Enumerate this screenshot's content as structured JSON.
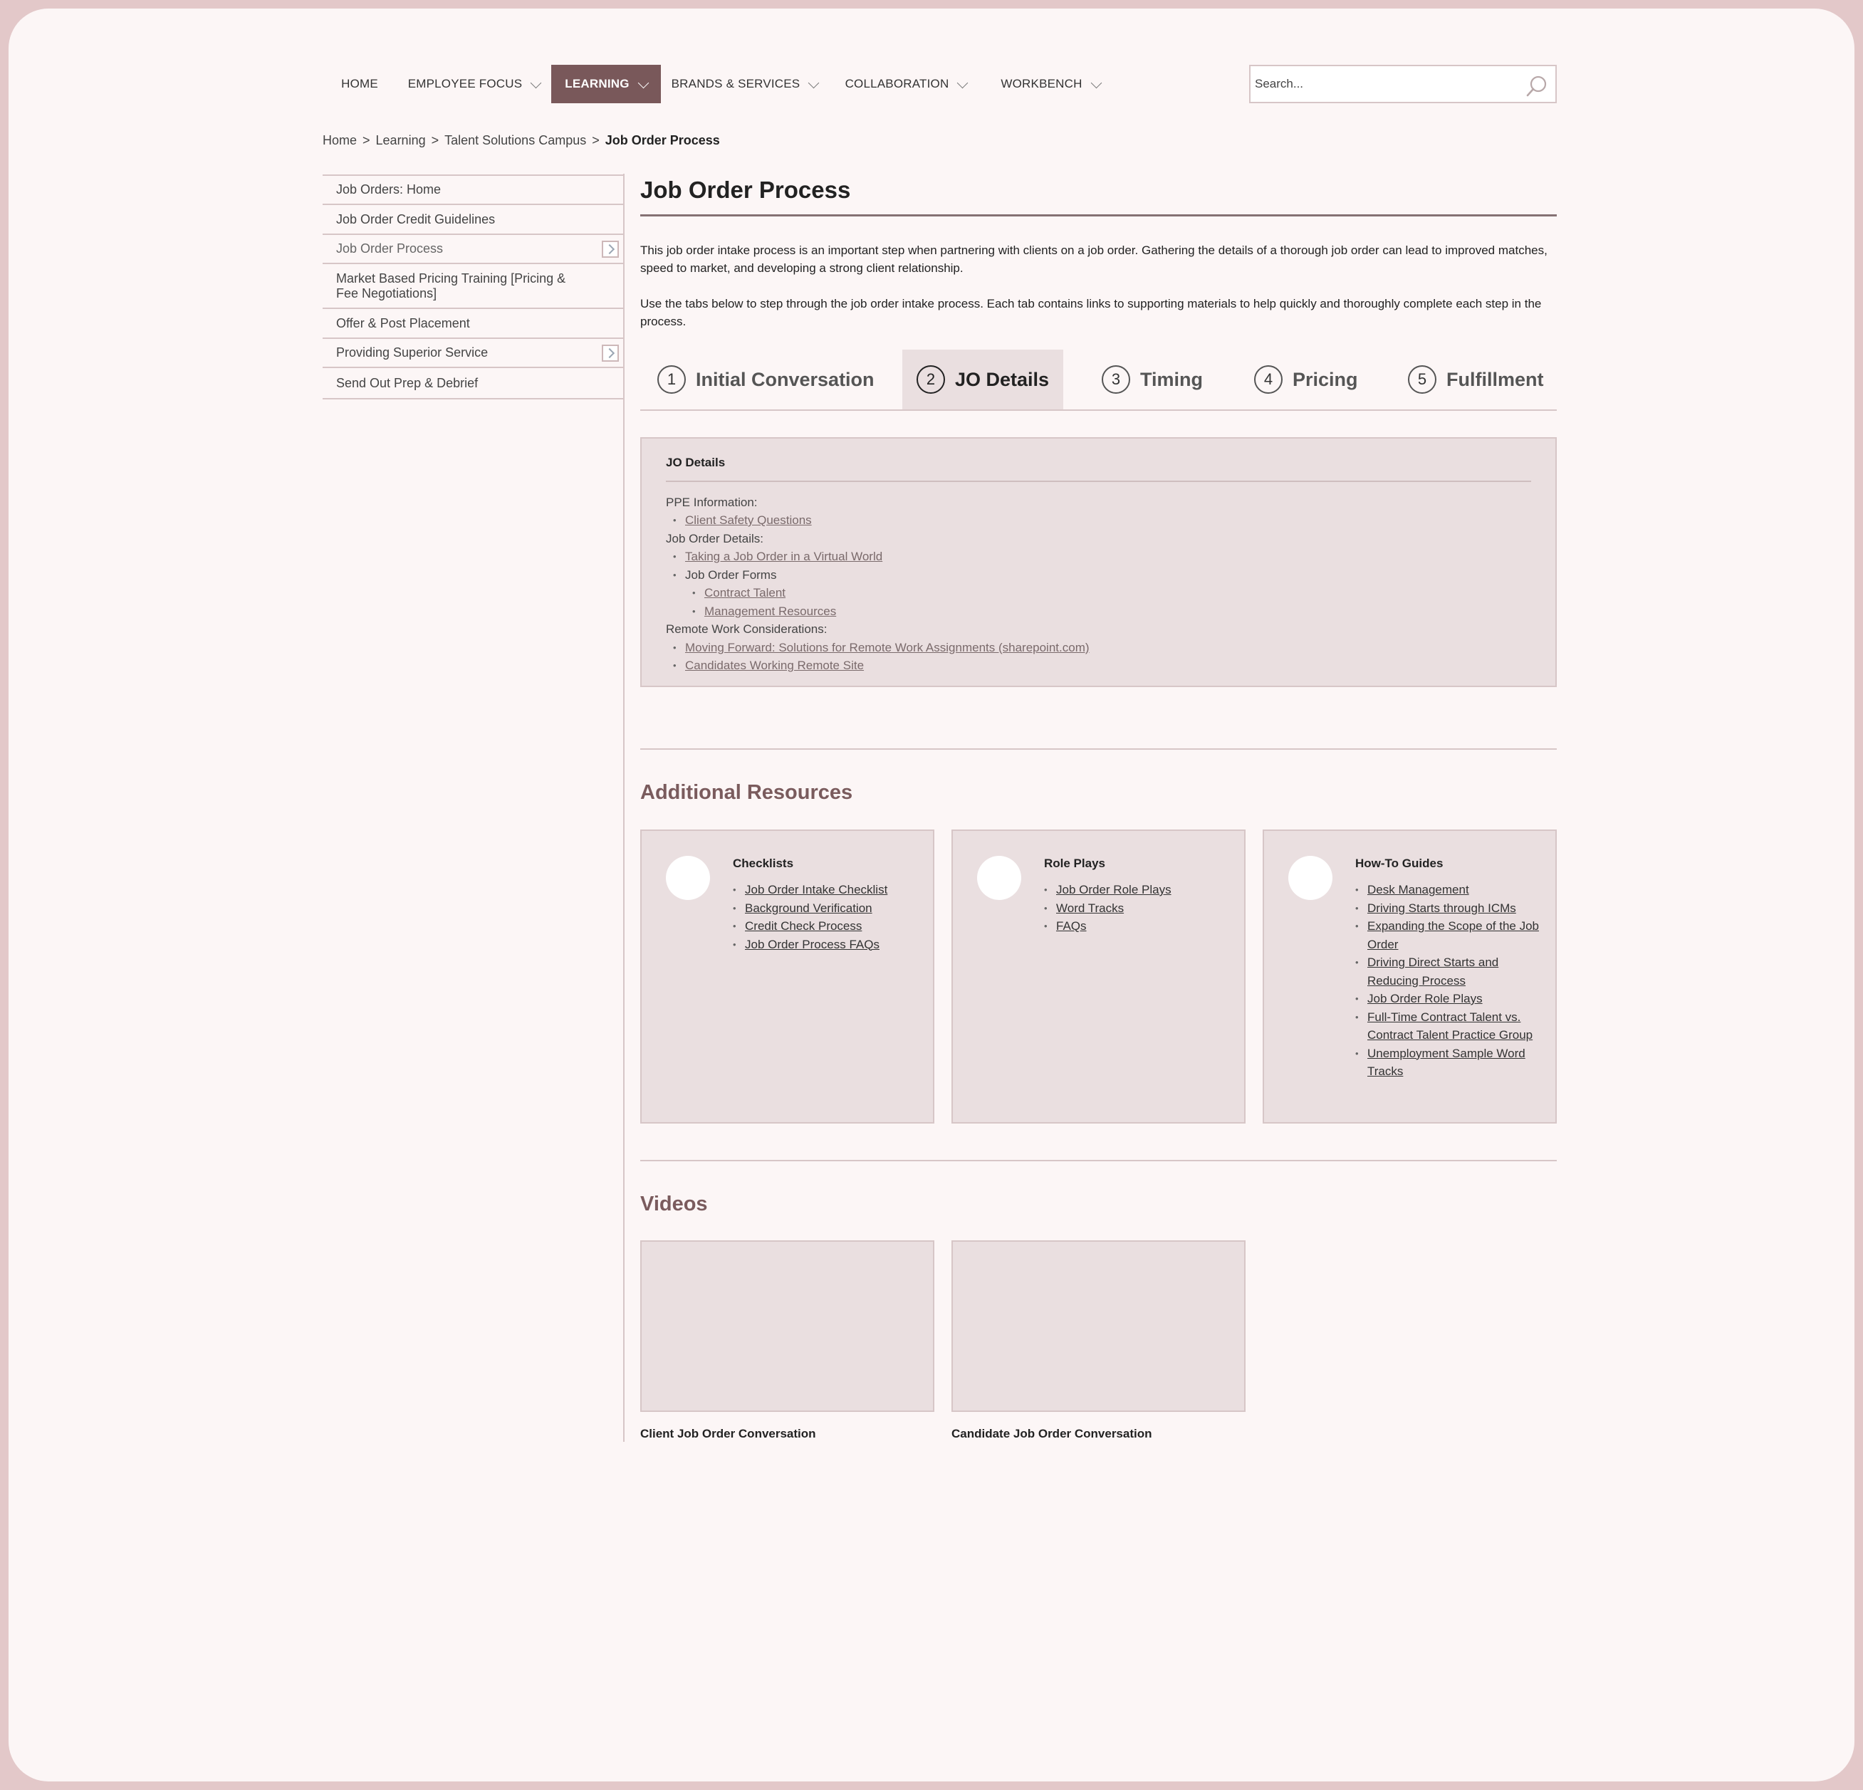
{
  "nav": {
    "items": [
      {
        "label": "HOME",
        "dropdown": false,
        "active": false
      },
      {
        "label": "EMPLOYEE FOCUS",
        "dropdown": true,
        "active": false
      },
      {
        "label": "LEARNING",
        "dropdown": true,
        "active": true
      },
      {
        "label": "BRANDS & SERVICES",
        "dropdown": true,
        "active": false
      },
      {
        "label": "COLLABORATION",
        "dropdown": true,
        "active": false
      },
      {
        "label": "WORKBENCH",
        "dropdown": true,
        "active": false
      }
    ],
    "search_placeholder": "Search...",
    "search_icon": "search-icon",
    "active_color": "#79585a"
  },
  "breadcrumb": {
    "items": [
      "Home",
      "Learning",
      "Talent Solutions Campus"
    ],
    "separator": ">",
    "current": "Job Order Process"
  },
  "sidebar": {
    "items": [
      {
        "label": "Job Orders: Home",
        "has_arrow": false
      },
      {
        "label": "Job Order Credit Guidelines",
        "has_arrow": false
      },
      {
        "label": "Job Order Process",
        "has_arrow": true
      },
      {
        "label": "Market Based Pricing Training [Pricing & Fee Negotiations]",
        "has_arrow": false
      },
      {
        "label": "Offer & Post Placement",
        "has_arrow": false
      },
      {
        "label": "Providing Superior Service",
        "has_arrow": true
      },
      {
        "label": "Send Out Prep & Debrief",
        "has_arrow": false
      }
    ]
  },
  "main": {
    "title": "Job Order Process",
    "intro": [
      "This job order intake process is an important step when partnering with clients on a job order. Gathering the details of a thorough job order can lead to improved matches, speed to market, and developing a strong client relationship.",
      "Use the tabs below to step through the job order intake process. Each tab contains links to supporting materials to help quickly and thoroughly complete each step in the process."
    ],
    "tabs": [
      {
        "num": "1",
        "label": "Initial Conversation",
        "active": false
      },
      {
        "num": "2",
        "label": "JO Details",
        "active": true
      },
      {
        "num": "3",
        "label": "Timing",
        "active": false
      },
      {
        "num": "4",
        "label": "Pricing",
        "active": false
      },
      {
        "num": "5",
        "label": "Fulfillment",
        "active": false
      }
    ],
    "panel": {
      "heading": "JO Details",
      "ppe_label": "PPE Information:",
      "client_safety": "Client Safety Questions",
      "details_label": "Job Order Details:",
      "virtual_world": "Taking a Job Order in a Virtual World",
      "forms": "Job Order Forms",
      "contract_talent": "Contract Talent",
      "management_resources": "Management Resources",
      "remote_label": "Remote Work Considerations:",
      "moving_forward": "Moving Forward: Solutions for Remote Work Assignments (sharepoint.com)",
      "candidates_remote": "Candidates Working Remote Site"
    },
    "additional_resources": {
      "title": "Additional Resources",
      "cards": [
        {
          "title": "Checklists",
          "links": [
            "Job Order Intake Checklist",
            "Background Verification",
            "Credit Check Process",
            "Job Order Process FAQs"
          ]
        },
        {
          "title": "Role Plays",
          "links": [
            "Job Order Role Plays",
            "Word Tracks",
            "FAQs"
          ]
        },
        {
          "title": "How-To Guides",
          "links": [
            "Desk Management",
            "Driving Starts through ICMs",
            "Expanding the Scope of the Job Order",
            "Driving Direct Starts and Reducing Process",
            "Job Order Role Plays",
            "Full-Time Contract Talent vs. Contract Talent Practice Group",
            "Unemployment Sample Word Tracks"
          ]
        }
      ]
    },
    "videos": {
      "title": "Videos",
      "items": [
        {
          "title": "Client Job Order Conversation"
        },
        {
          "title": "Candidate Job Order Conversation"
        }
      ]
    }
  }
}
